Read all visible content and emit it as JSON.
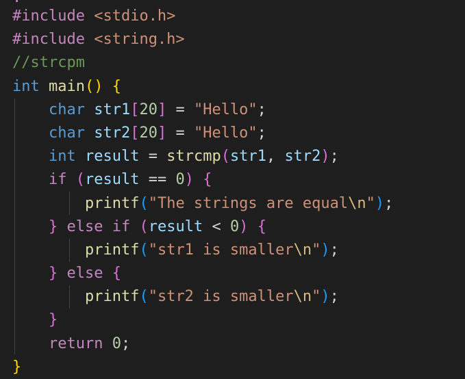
{
  "code": {
    "lines": [
      {
        "tokens": [
          {
            "t": "#include",
            "c": "t-ctrl"
          },
          {
            "t": " ",
            "c": "t-op"
          },
          {
            "t": "<stdio.h>",
            "c": "t-inc"
          }
        ]
      },
      {
        "tokens": [
          {
            "t": "#include",
            "c": "t-ctrl"
          },
          {
            "t": " ",
            "c": "t-op"
          },
          {
            "t": "<string.h>",
            "c": "t-inc"
          }
        ]
      },
      {
        "tokens": [
          {
            "t": "//strcpm",
            "c": "t-cmt"
          }
        ]
      },
      {
        "tokens": [
          {
            "t": "int",
            "c": "t-kw"
          },
          {
            "t": " ",
            "c": "t-op"
          },
          {
            "t": "main",
            "c": "t-fn"
          },
          {
            "t": "()",
            "c": "b1"
          },
          {
            "t": " ",
            "c": "t-op"
          },
          {
            "t": "{",
            "c": "b1"
          }
        ]
      },
      {
        "tokens": [
          {
            "t": "    ",
            "c": "t-op"
          },
          {
            "t": "char",
            "c": "t-kw"
          },
          {
            "t": " ",
            "c": "t-op"
          },
          {
            "t": "str1",
            "c": "t-var"
          },
          {
            "t": "[",
            "c": "b2"
          },
          {
            "t": "20",
            "c": "t-num"
          },
          {
            "t": "]",
            "c": "b2"
          },
          {
            "t": " = ",
            "c": "t-op"
          },
          {
            "t": "\"Hello\"",
            "c": "t-str"
          },
          {
            "t": ";",
            "c": "t-op"
          }
        ]
      },
      {
        "tokens": [
          {
            "t": "    ",
            "c": "t-op"
          },
          {
            "t": "char",
            "c": "t-kw"
          },
          {
            "t": " ",
            "c": "t-op"
          },
          {
            "t": "str2",
            "c": "t-var"
          },
          {
            "t": "[",
            "c": "b2"
          },
          {
            "t": "20",
            "c": "t-num"
          },
          {
            "t": "]",
            "c": "b2"
          },
          {
            "t": " = ",
            "c": "t-op"
          },
          {
            "t": "\"Hello\"",
            "c": "t-str"
          },
          {
            "t": ";",
            "c": "t-op"
          }
        ]
      },
      {
        "tokens": [
          {
            "t": "    ",
            "c": "t-op"
          },
          {
            "t": "int",
            "c": "t-kw"
          },
          {
            "t": " ",
            "c": "t-op"
          },
          {
            "t": "result",
            "c": "t-var"
          },
          {
            "t": " = ",
            "c": "t-op"
          },
          {
            "t": "strcmp",
            "c": "t-fn"
          },
          {
            "t": "(",
            "c": "b2"
          },
          {
            "t": "str1",
            "c": "t-var"
          },
          {
            "t": ", ",
            "c": "t-op"
          },
          {
            "t": "str2",
            "c": "t-var"
          },
          {
            "t": ")",
            "c": "b2"
          },
          {
            "t": ";",
            "c": "t-op"
          }
        ]
      },
      {
        "tokens": [
          {
            "t": "    ",
            "c": "t-op"
          },
          {
            "t": "if",
            "c": "t-ctrl"
          },
          {
            "t": " ",
            "c": "t-op"
          },
          {
            "t": "(",
            "c": "b2"
          },
          {
            "t": "result",
            "c": "t-var"
          },
          {
            "t": " == ",
            "c": "t-op"
          },
          {
            "t": "0",
            "c": "t-num"
          },
          {
            "t": ")",
            "c": "b2"
          },
          {
            "t": " ",
            "c": "t-op"
          },
          {
            "t": "{",
            "c": "b2"
          }
        ]
      },
      {
        "tokens": [
          {
            "t": "        ",
            "c": "t-op"
          },
          {
            "t": "printf",
            "c": "t-fn"
          },
          {
            "t": "(",
            "c": "b3"
          },
          {
            "t": "\"The strings are equal",
            "c": "t-str"
          },
          {
            "t": "\\n",
            "c": "t-esc"
          },
          {
            "t": "\"",
            "c": "t-str"
          },
          {
            "t": ")",
            "c": "b3"
          },
          {
            "t": ";",
            "c": "t-op"
          }
        ]
      },
      {
        "tokens": [
          {
            "t": "    ",
            "c": "t-op"
          },
          {
            "t": "}",
            "c": "b2"
          },
          {
            "t": " ",
            "c": "t-op"
          },
          {
            "t": "else",
            "c": "t-ctrl"
          },
          {
            "t": " ",
            "c": "t-op"
          },
          {
            "t": "if",
            "c": "t-ctrl"
          },
          {
            "t": " ",
            "c": "t-op"
          },
          {
            "t": "(",
            "c": "b2"
          },
          {
            "t": "result",
            "c": "t-var"
          },
          {
            "t": " < ",
            "c": "t-op"
          },
          {
            "t": "0",
            "c": "t-num"
          },
          {
            "t": ")",
            "c": "b2"
          },
          {
            "t": " ",
            "c": "t-op"
          },
          {
            "t": "{",
            "c": "b2"
          }
        ]
      },
      {
        "tokens": [
          {
            "t": "        ",
            "c": "t-op"
          },
          {
            "t": "printf",
            "c": "t-fn"
          },
          {
            "t": "(",
            "c": "b3"
          },
          {
            "t": "\"str1 is smaller",
            "c": "t-str"
          },
          {
            "t": "\\n",
            "c": "t-esc"
          },
          {
            "t": "\"",
            "c": "t-str"
          },
          {
            "t": ")",
            "c": "b3"
          },
          {
            "t": ";",
            "c": "t-op"
          }
        ]
      },
      {
        "tokens": [
          {
            "t": "    ",
            "c": "t-op"
          },
          {
            "t": "}",
            "c": "b2"
          },
          {
            "t": " ",
            "c": "t-op"
          },
          {
            "t": "else",
            "c": "t-ctrl"
          },
          {
            "t": " ",
            "c": "t-op"
          },
          {
            "t": "{",
            "c": "b2"
          }
        ]
      },
      {
        "tokens": [
          {
            "t": "        ",
            "c": "t-op"
          },
          {
            "t": "printf",
            "c": "t-fn"
          },
          {
            "t": "(",
            "c": "b3"
          },
          {
            "t": "\"str2 is smaller",
            "c": "t-str"
          },
          {
            "t": "\\n",
            "c": "t-esc"
          },
          {
            "t": "\"",
            "c": "t-str"
          },
          {
            "t": ")",
            "c": "b3"
          },
          {
            "t": ";",
            "c": "t-op"
          }
        ]
      },
      {
        "tokens": [
          {
            "t": "    ",
            "c": "t-op"
          },
          {
            "t": "}",
            "c": "b2"
          }
        ]
      },
      {
        "tokens": [
          {
            "t": "    ",
            "c": "t-op"
          },
          {
            "t": "return",
            "c": "t-ctrl"
          },
          {
            "t": " ",
            "c": "t-op"
          },
          {
            "t": "0",
            "c": "t-num"
          },
          {
            "t": ";",
            "c": "t-op"
          }
        ]
      },
      {
        "tokens": [
          {
            "t": "}",
            "c": "b1"
          }
        ]
      }
    ]
  },
  "theme": {
    "background": "#1e1e1e",
    "foreground": "#d4d4d4",
    "keyword": "#569cd6",
    "control": "#c586c0",
    "function": "#dcdcaa",
    "variable": "#9cdcfe",
    "number": "#b5cea8",
    "string": "#ce9178",
    "comment": "#6a9955",
    "bracket_1": "#ffd700",
    "bracket_2": "#da70d6",
    "bracket_3": "#179fff"
  }
}
